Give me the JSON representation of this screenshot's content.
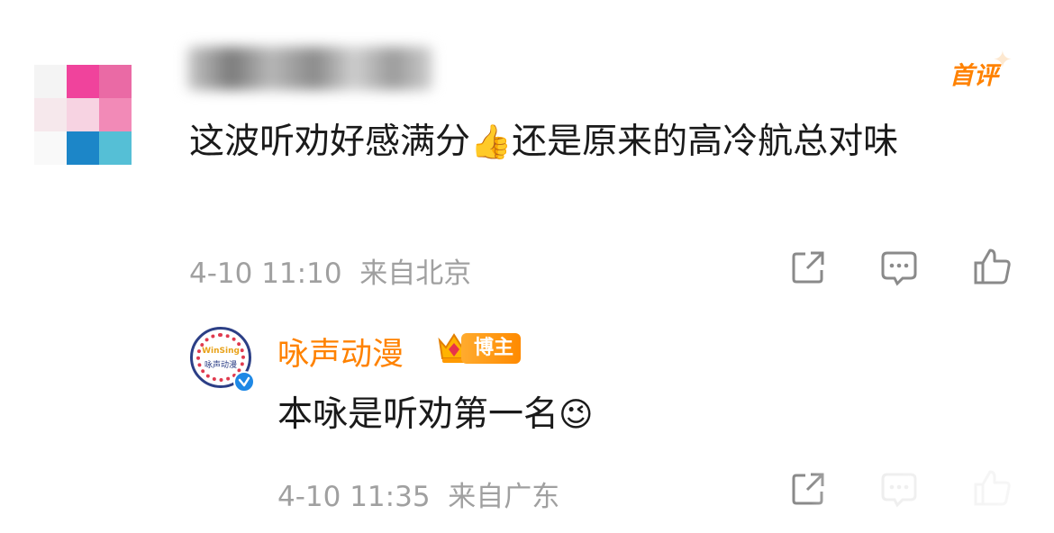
{
  "main_comment": {
    "badge": "首评",
    "text": "这波听劝好感满分",
    "emoji": "👍",
    "text_after": "还是原来的高冷航总对味",
    "time": "4-10 11:10",
    "location": "来自北京"
  },
  "reply": {
    "username": "咏声动漫",
    "avatar_logo_line1": "WinSing",
    "avatar_logo_line2": "咏声动漫",
    "badge": "博主",
    "text": "本咏是听劝第一名",
    "emoji": "😉",
    "time": "4-10 11:35",
    "location": "来自广东"
  },
  "icons": {
    "share": "share-icon",
    "comment": "comment-icon",
    "like": "thumbs-up-icon",
    "verified": "verified-icon",
    "crown": "crown-icon"
  },
  "colors": {
    "accent_orange": "#ff8200",
    "text_main": "#1a1a1a",
    "text_meta": "#a0a0a0",
    "verified_blue": "#1e88e5"
  }
}
